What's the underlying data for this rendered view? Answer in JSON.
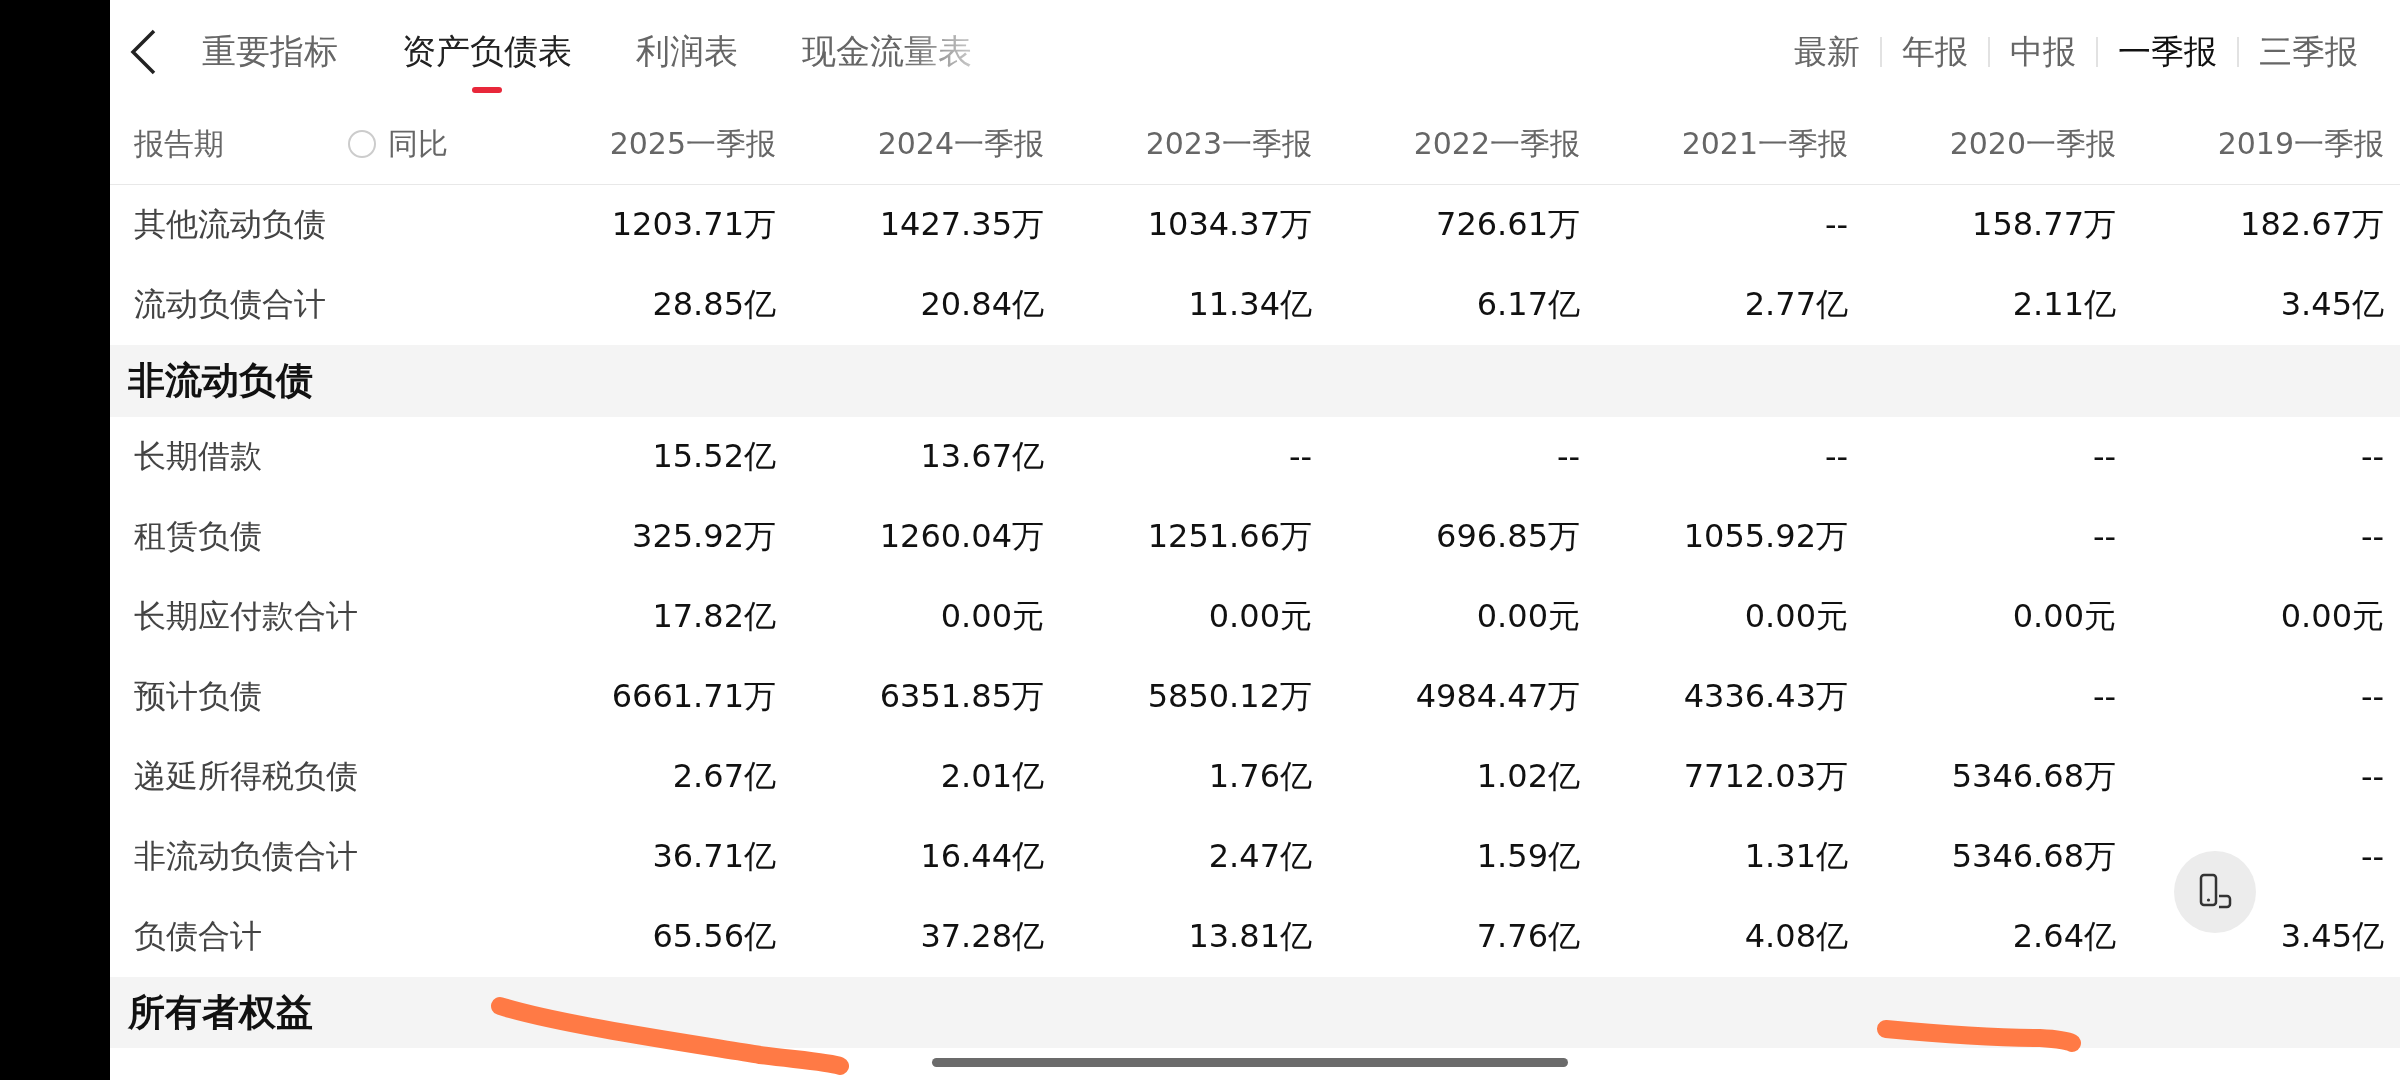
{
  "top_tabs": [
    {
      "label": "重要指标",
      "selected": false
    },
    {
      "label": "资产负债表",
      "selected": true
    },
    {
      "label": "利润表",
      "selected": false
    },
    {
      "label": "现金流量表",
      "selected": false
    }
  ],
  "period_filters": [
    {
      "label": "最新",
      "selected": false
    },
    {
      "label": "年报",
      "selected": false
    },
    {
      "label": "中报",
      "selected": false
    },
    {
      "label": "一季报",
      "selected": true
    },
    {
      "label": "三季报",
      "selected": false
    }
  ],
  "table": {
    "label_header": "报告期",
    "yoy_toggle": {
      "label": "同比",
      "checked": false
    },
    "columns": [
      "2025一季报",
      "2024一季报",
      "2023一季报",
      "2022一季报",
      "2021一季报",
      "2020一季报",
      "2019一季报"
    ],
    "rows": [
      {
        "kind": "row",
        "label": "其他流动负债",
        "values": [
          "1203.71万",
          "1427.35万",
          "1034.37万",
          "726.61万",
          "--",
          "158.77万",
          "182.67万"
        ]
      },
      {
        "kind": "row",
        "label": "流动负债合计",
        "values": [
          "28.85亿",
          "20.84亿",
          "11.34亿",
          "6.17亿",
          "2.77亿",
          "2.11亿",
          "3.45亿"
        ]
      },
      {
        "kind": "section",
        "label": "非流动负债"
      },
      {
        "kind": "row",
        "label": "长期借款",
        "values": [
          "15.52亿",
          "13.67亿",
          "--",
          "--",
          "--",
          "--",
          "--"
        ]
      },
      {
        "kind": "row",
        "label": "租赁负债",
        "values": [
          "325.92万",
          "1260.04万",
          "1251.66万",
          "696.85万",
          "1055.92万",
          "--",
          "--"
        ]
      },
      {
        "kind": "row",
        "label": "长期应付款合计",
        "values": [
          "17.82亿",
          "0.00元",
          "0.00元",
          "0.00元",
          "0.00元",
          "0.00元",
          "0.00元"
        ]
      },
      {
        "kind": "row",
        "label": "预计负债",
        "values": [
          "6661.71万",
          "6351.85万",
          "5850.12万",
          "4984.47万",
          "4336.43万",
          "--",
          "--"
        ]
      },
      {
        "kind": "row",
        "label": "递延所得税负债",
        "values": [
          "2.67亿",
          "2.01亿",
          "1.76亿",
          "1.02亿",
          "7712.03万",
          "5346.68万",
          "--"
        ]
      },
      {
        "kind": "row",
        "label": "非流动负债合计",
        "values": [
          "36.71亿",
          "16.44亿",
          "2.47亿",
          "1.59亿",
          "1.31亿",
          "5346.68万",
          "--"
        ]
      },
      {
        "kind": "row",
        "label": "负债合计",
        "values": [
          "65.56亿",
          "37.28亿",
          "13.81亿",
          "7.76亿",
          "4.08亿",
          "2.64亿",
          "3.45亿"
        ]
      },
      {
        "kind": "section",
        "label": "所有者权益"
      }
    ]
  }
}
